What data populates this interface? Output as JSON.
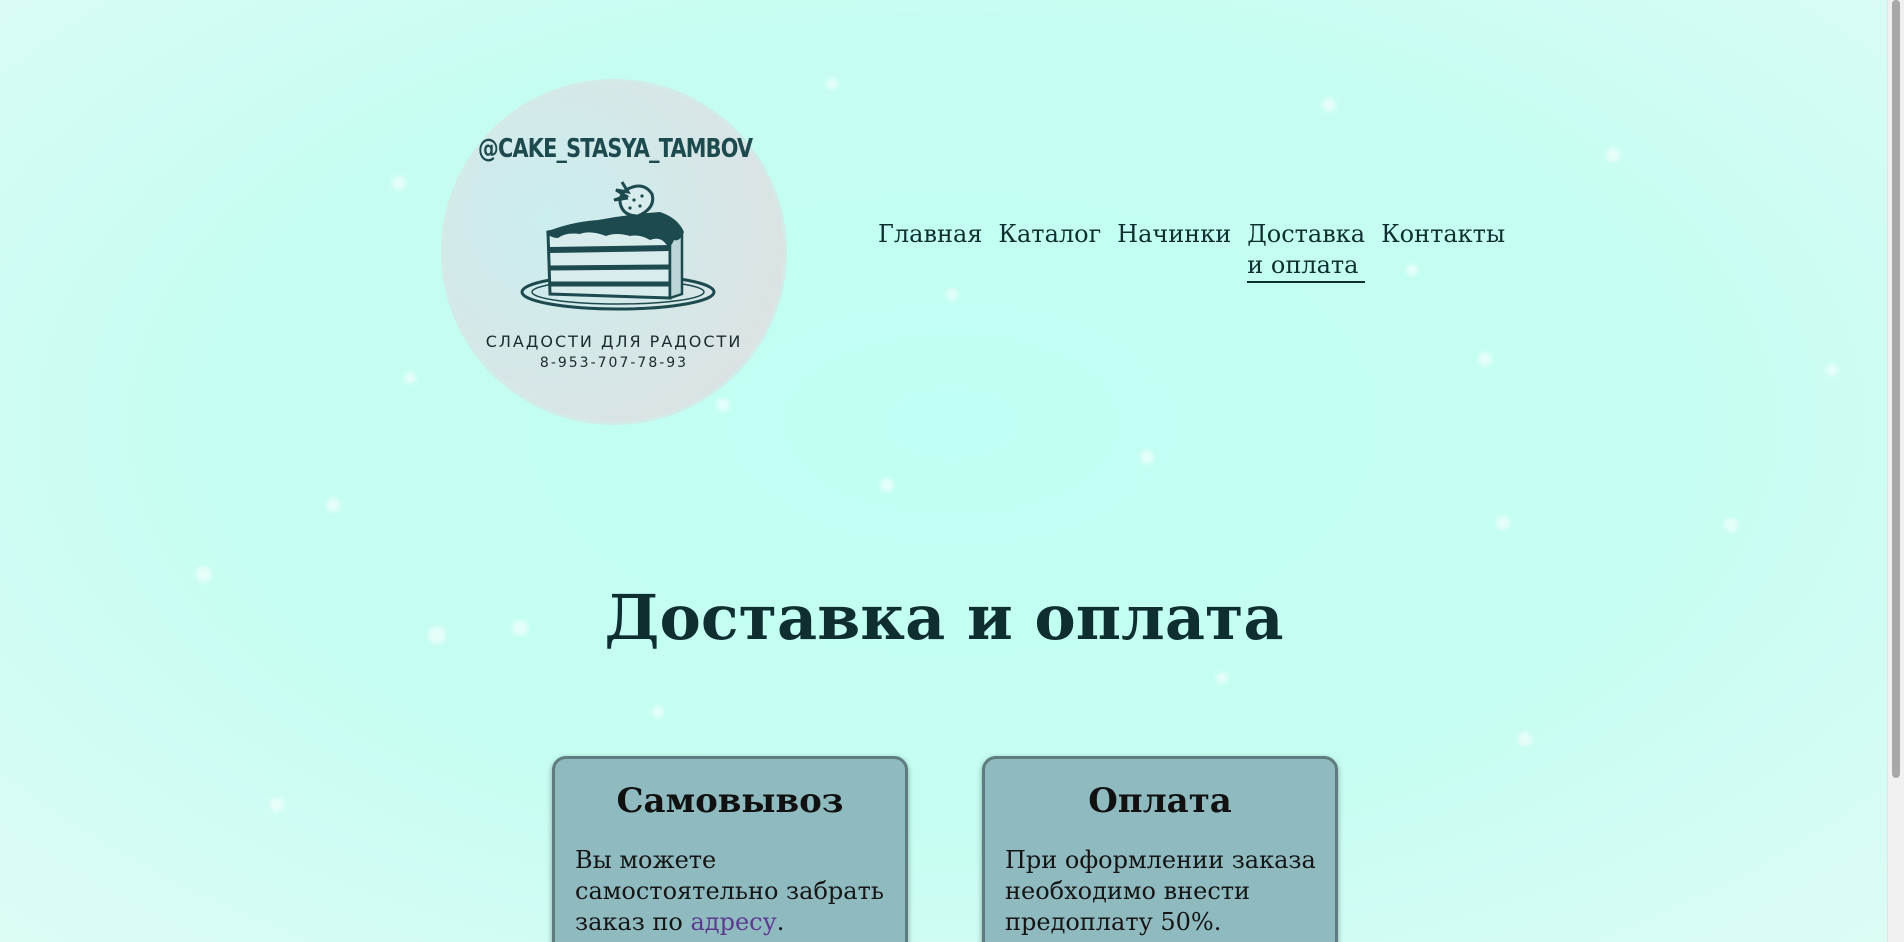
{
  "logo": {
    "handle": "@CAKE_STASYA_TAMBOV",
    "tagline": "СЛАДОСТИ ДЛЯ РАДОСТИ",
    "phone": "8-953-707-78-93",
    "image": "cake-slice-icon"
  },
  "nav": {
    "items": [
      {
        "label": "Главная"
      },
      {
        "label": "Каталог"
      },
      {
        "label": "Начинки"
      },
      {
        "label": "Доставка\nи оплата",
        "line1": "Доставка",
        "line2": "и оплата",
        "active": true
      },
      {
        "label": "Контакты"
      }
    ]
  },
  "main": {
    "title": "Доставка и оплата",
    "cards": [
      {
        "title": "Самовывоз",
        "text_before_link": "Вы можете самостоятельно забрать заказ по ",
        "link_text": "адресу",
        "text_after_link": "."
      },
      {
        "title": "Оплата",
        "text": "При оформлении заказа необходимо внести предоплату 50%."
      }
    ]
  },
  "colors": {
    "background": "#c4fdf1",
    "card_bg": "#8fbbc0",
    "text_dark": "#0f2e2f",
    "link": "#5b3a8d",
    "logo_teal": "#1c4a4e"
  }
}
